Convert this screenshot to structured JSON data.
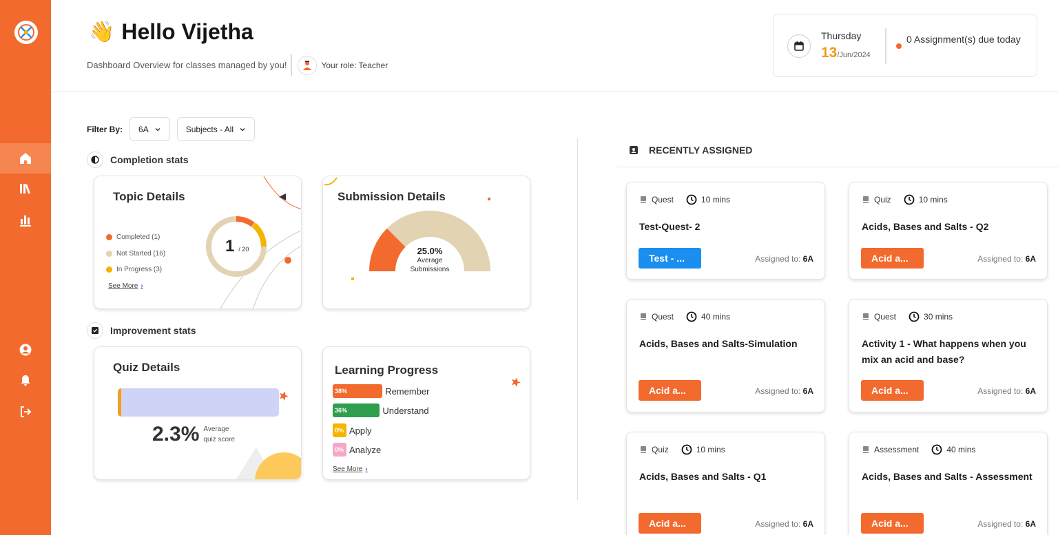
{
  "header": {
    "greeting_emoji": "👋",
    "greeting": "Hello Vijetha",
    "subtitle": "Dashboard Overview for classes managed by you!",
    "role": "Your role: Teacher"
  },
  "datebox": {
    "day_name": "Thursday",
    "day_number": "13",
    "month_year": "/Jun/2024",
    "due_text": "0 Assignment(s) due today"
  },
  "sidebar": {
    "items": [
      {
        "icon": "home-icon"
      },
      {
        "icon": "library-icon"
      },
      {
        "icon": "bar-chart-icon"
      },
      {
        "icon": "user-circle-icon"
      },
      {
        "icon": "bell-icon"
      },
      {
        "icon": "logout-icon"
      }
    ]
  },
  "filter": {
    "label": "Filter By:",
    "class_value": "6A",
    "subject_value": "Subjects - All"
  },
  "completion": {
    "heading": "Completion stats",
    "topic": {
      "title": "Topic Details",
      "legend": [
        {
          "label": "Completed (1)",
          "color": "#f26a2e"
        },
        {
          "label": "Not Started (16)",
          "color": "#e2d3b3"
        },
        {
          "label": "In Progress (3)",
          "color": "#f5b400"
        }
      ],
      "see_more": "See More",
      "value": "1",
      "total": "/ 20"
    },
    "submission": {
      "title": "Submission Details",
      "percent": "25.0%",
      "caption": "Average Submissions",
      "fraction": 0.25
    }
  },
  "improvement": {
    "heading": "Improvement stats",
    "quiz": {
      "title": "Quiz Details",
      "percent": "2.3%",
      "caption": "Average quiz score",
      "fraction": 0.023
    },
    "learning": {
      "title": "Learning Progress",
      "rows": [
        {
          "pct": "38%",
          "label": "Remember",
          "color": "#f26a2e",
          "fraction": 0.38
        },
        {
          "pct": "36%",
          "label": "Understand",
          "color": "#2e9e4e",
          "fraction": 0.36
        },
        {
          "pct": "0%",
          "label": "Apply",
          "color": "#f5b400",
          "fraction": 0
        },
        {
          "pct": "0%",
          "label": "Analyze",
          "color": "#f4a8c8",
          "fraction": 0
        }
      ],
      "see_more": "See More"
    }
  },
  "recent": {
    "heading": "RECENTLY ASSIGNED",
    "cards": [
      {
        "type": "Quest",
        "duration": "10 mins",
        "title": "Test-Quest- 2",
        "button": "Test - ...",
        "button_color": "#1a8ff0",
        "assigned_label": "Assigned to:",
        "assigned_to": "6A"
      },
      {
        "type": "Quiz",
        "duration": "10 mins",
        "title": "Acids, Bases and Salts - Q2",
        "button": "Acid a...",
        "button_color": "#f26a2e",
        "assigned_label": "Assigned to:",
        "assigned_to": "6A"
      },
      {
        "type": "Quest",
        "duration": "40 mins",
        "title": "Acids, Bases and Salts-Simulation",
        "button": "Acid a...",
        "button_color": "#f26a2e",
        "assigned_label": "Assigned to:",
        "assigned_to": "6A"
      },
      {
        "type": "Quest",
        "duration": "30 mins",
        "title": "Activity 1 - What happens when you mix an acid and base?",
        "button": "Acid a...",
        "button_color": "#f26a2e",
        "assigned_label": "Assigned to:",
        "assigned_to": "6A"
      },
      {
        "type": "Quiz",
        "duration": "10 mins",
        "title": "Acids, Bases and Salts - Q1",
        "button": "Acid a...",
        "button_color": "#f26a2e",
        "assigned_label": "Assigned to:",
        "assigned_to": "6A"
      },
      {
        "type": "Assessment",
        "duration": "40 mins",
        "title": "Acids, Bases and Salts - Assessment",
        "button": "Acid a...",
        "button_color": "#f26a2e",
        "assigned_label": "Assigned to:",
        "assigned_to": "6A"
      }
    ]
  }
}
